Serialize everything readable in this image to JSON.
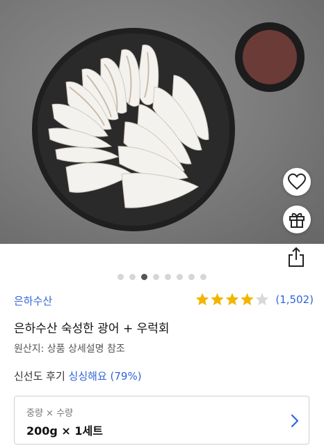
{
  "product": {
    "seller": "은하수산",
    "title": "은하수산 숙성한 광어 + 우럭회",
    "origin": "원산지: 상품 상세설명 참조",
    "rating": {
      "stars": 4,
      "max": 5,
      "count": "(1,502)"
    },
    "freshness": {
      "prefix": "신선도 후기 ",
      "value": "싱싱해요 (79%)"
    }
  },
  "gallery": {
    "total_images": 8,
    "active_index": 3
  },
  "option": {
    "label": "중량 × 수량",
    "value": "200g × 1세트"
  },
  "icons": {
    "wishlist": "heart-icon",
    "gift": "gift-icon",
    "share": "share-icon",
    "option_open": "chevron-right-icon",
    "star": "star-icon"
  },
  "colors": {
    "accent": "#2f64d8",
    "star_filled": "#f4b400",
    "star_empty": "#d8d8d8"
  }
}
